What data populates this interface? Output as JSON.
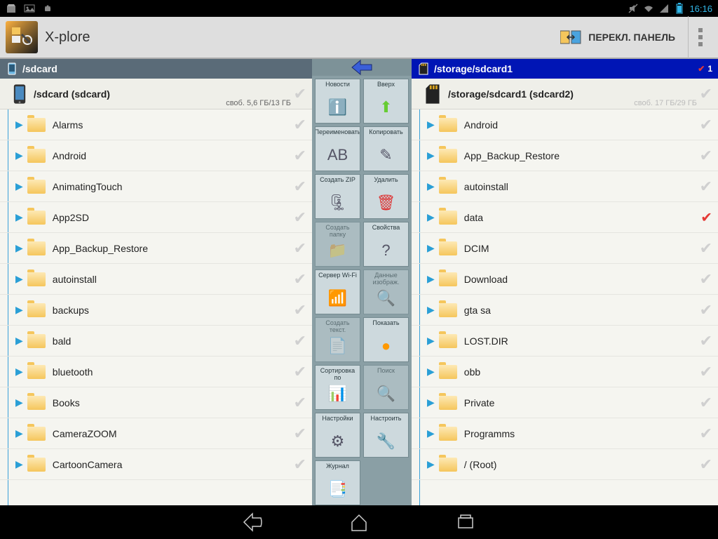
{
  "status": {
    "time": "16:16"
  },
  "appbar": {
    "title": "X-plore",
    "switch_label": "ПЕРЕКЛ. ПАНЕЛЬ"
  },
  "left_pane": {
    "header_path": "/sdcard",
    "storage": {
      "name": "/sdcard (sdcard)",
      "free": "своб. 5,6 ГБ/13 ГБ"
    },
    "items": [
      {
        "label": "Alarms"
      },
      {
        "label": "Android"
      },
      {
        "label": "AnimatingTouch"
      },
      {
        "label": "App2SD"
      },
      {
        "label": "App_Backup_Restore"
      },
      {
        "label": "autoinstall"
      },
      {
        "label": "backups"
      },
      {
        "label": "bald"
      },
      {
        "label": "bluetooth"
      },
      {
        "label": "Books"
      },
      {
        "label": "CameraZOOM"
      },
      {
        "label": "CartoonCamera"
      }
    ]
  },
  "right_pane": {
    "header_prefix": "/storage/",
    "header_bold": "sdcard1",
    "header_count": "1",
    "storage": {
      "name": "/storage/sdcard1 (sdcard2)",
      "free": "своб. 17 ГБ/29 ГБ"
    },
    "items": [
      {
        "label": "Android"
      },
      {
        "label": "App_Backup_Restore"
      },
      {
        "label": "autoinstall"
      },
      {
        "label": "data",
        "marked": true
      },
      {
        "label": "DCIM"
      },
      {
        "label": "Download"
      },
      {
        "label": "gta sa"
      },
      {
        "label": "LOST.DIR"
      },
      {
        "label": "obb"
      },
      {
        "label": "Private"
      },
      {
        "label": "Programms"
      },
      {
        "label": "/ (Root)"
      }
    ]
  },
  "tools": [
    {
      "label": "Новости",
      "icon": "ℹ️"
    },
    {
      "label": "Вверх",
      "icon": "⬆",
      "color": "#6c3"
    },
    {
      "label": "Переименовать",
      "icon": "AB"
    },
    {
      "label": "Копировать",
      "icon": "✎"
    },
    {
      "label": "Создать ZIP",
      "icon": "🗜"
    },
    {
      "label": "Удалить",
      "icon": "🗑",
      "color": "#d33"
    },
    {
      "label": "Создать папку",
      "icon": "📁",
      "disabled": true
    },
    {
      "label": "Свойства",
      "icon": "?"
    },
    {
      "label": "Сервер Wi-Fi",
      "icon": "📶",
      "color": "#39f"
    },
    {
      "label": "Данные изображ.",
      "icon": "🔍",
      "disabled": true
    },
    {
      "label": "Создать текст.",
      "icon": "📄",
      "disabled": true
    },
    {
      "label": "Показать",
      "icon": "●",
      "color": "#f90"
    },
    {
      "label": "Сортировка по",
      "icon": "📊"
    },
    {
      "label": "Поиск",
      "icon": "🔍",
      "disabled": true
    },
    {
      "label": "Настройки",
      "icon": "⚙"
    },
    {
      "label": "Настроить",
      "icon": "🔧"
    },
    {
      "label": "Журнал",
      "icon": "📑"
    }
  ]
}
